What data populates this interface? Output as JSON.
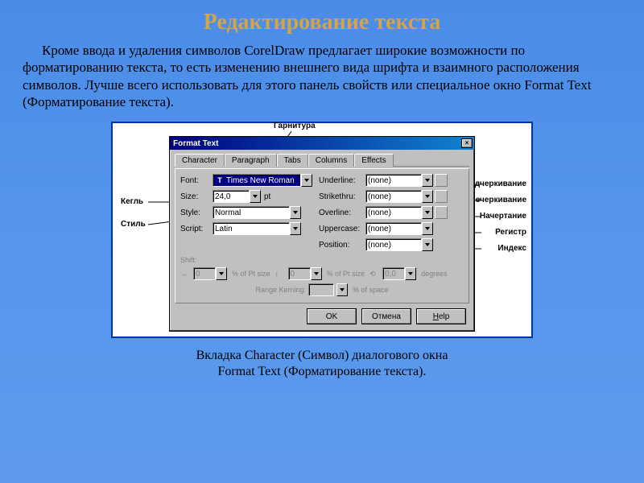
{
  "title": "Редактирование текста",
  "paragraph": "Кроме ввода и удаления символов CorelDraw  предлагает широкие возможности по форматированию текста, то есть изменению внешнего вида шрифта и взаимного расположения символов. Лучше всего использовать для этого панель свойств или специальное окно Format Text (Форматирование текста).",
  "caption_line1": "Вкладка Character (Символ) диалогового окна",
  "caption_line2": "Format Text (Форматирование текста).",
  "callouts": {
    "garnitura": "Гарнитура",
    "kegl": "Кегль",
    "style": "Стиль",
    "underline": "Подчеркивание",
    "strike": "Перечеркивание",
    "overline": "Начертание",
    "uppercase": "Регистр",
    "position": "Индекс"
  },
  "dialog": {
    "title": "Format Text",
    "close_glyph": "×",
    "tabs": [
      "Character",
      "Paragraph",
      "Tabs",
      "Columns",
      "Effects"
    ],
    "left": {
      "font_label": "Font:",
      "font_value": "Times New Roman",
      "size_label": "Size:",
      "size_value": "24,0",
      "size_unit": "pt",
      "style_label": "Style:",
      "style_value": "Normal",
      "script_label": "Script:",
      "script_value": "Latin"
    },
    "right": {
      "underline_label": "Underline:",
      "underline_value": "(none)",
      "strike_label": "Strikethru:",
      "strike_value": "(none)",
      "overline_label": "Overline:",
      "overline_value": "(none)",
      "uppercase_label": "Uppercase:",
      "uppercase_value": "(none)",
      "position_label": "Position:",
      "position_value": "(none)"
    },
    "shift": {
      "label": "Shift:",
      "h_val": "0",
      "h_unit": "% of Pt size",
      "v_val": "0",
      "v_unit": "% of Pt size",
      "rot_val": "0,0",
      "rot_unit": "degrees",
      "kern_label": "Range Kerning:",
      "kern_val": "",
      "kern_unit": "% of space"
    },
    "buttons": {
      "ok": "OK",
      "cancel": "Отмена",
      "help_label": "Help"
    }
  }
}
